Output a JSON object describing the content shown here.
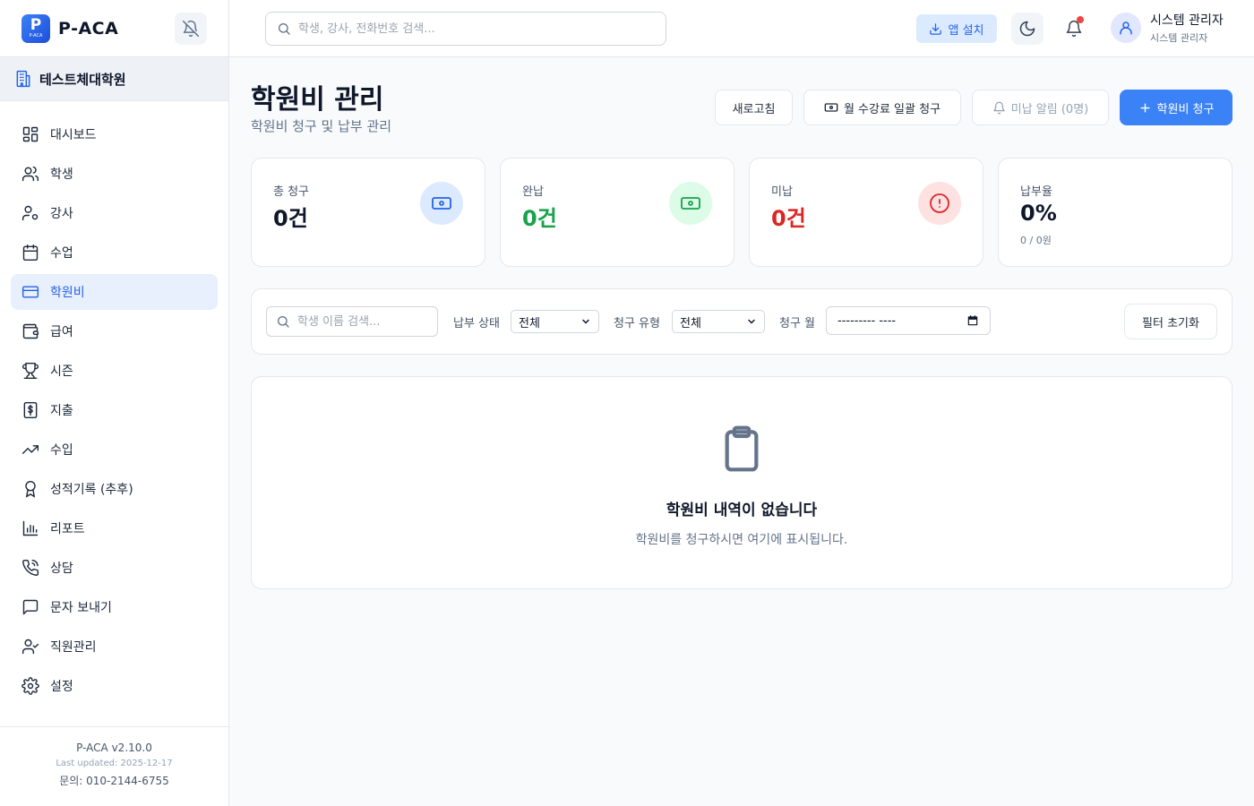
{
  "sidebar": {
    "logo_text": "P",
    "logo_sub": "P-ACA",
    "brand": "P-ACA",
    "academy": "테스트체대학원",
    "items": [
      {
        "label": "대시보드",
        "icon": "dashboard-icon"
      },
      {
        "label": "학생",
        "icon": "users-icon"
      },
      {
        "label": "강사",
        "icon": "user-cog-icon"
      },
      {
        "label": "수업",
        "icon": "calendar-icon"
      },
      {
        "label": "학원비",
        "icon": "credit-card-icon"
      },
      {
        "label": "급여",
        "icon": "wallet-icon"
      },
      {
        "label": "시즌",
        "icon": "trophy-icon"
      },
      {
        "label": "지출",
        "icon": "dollar-receipt-icon"
      },
      {
        "label": "수입",
        "icon": "trending-up-icon"
      },
      {
        "label": "성적기록 (추후)",
        "icon": "award-icon"
      },
      {
        "label": "리포트",
        "icon": "bar-chart-icon"
      },
      {
        "label": "상담",
        "icon": "phone-icon"
      },
      {
        "label": "문자 보내기",
        "icon": "message-icon"
      },
      {
        "label": "직원관리",
        "icon": "user-check-icon"
      },
      {
        "label": "설정",
        "icon": "settings-icon"
      }
    ],
    "active_index": 4,
    "footer": {
      "version": "P-ACA v2.10.0",
      "updated": "Last updated: 2025-12-17",
      "contact": "문의: 010-2144-6755"
    }
  },
  "header": {
    "search_placeholder": "학생, 강사, 전화번호 검색...",
    "install_label": "앱 설치",
    "user_name": "시스템 관리자",
    "user_role": "시스템 관리자"
  },
  "page": {
    "title": "학원비 관리",
    "subtitle": "학원비 청구 및 납부 관리",
    "buttons": {
      "refresh": "새로고침",
      "bulk": "월 수강료 일괄 청구",
      "unpaid_alert": "미납 알림 (0명)",
      "charge": "학원비 청구"
    }
  },
  "stats": [
    {
      "label": "총 청구",
      "value": "0건",
      "color": "#0f172a",
      "icon_bg": "#dbeafe",
      "icon_color": "#2563eb"
    },
    {
      "label": "완납",
      "value": "0건",
      "color": "#16a34a",
      "icon_bg": "#dcfce7",
      "icon_color": "#16a34a"
    },
    {
      "label": "미납",
      "value": "0건",
      "color": "#dc2626",
      "icon_bg": "#fee2e2",
      "icon_color": "#dc2626"
    },
    {
      "label": "납부율",
      "value": "0%",
      "color": "#0f172a",
      "sub": "0 / 0원"
    }
  ],
  "filters": {
    "search_placeholder": "학생 이름 검색...",
    "status_label": "납부 상태",
    "status_value": "전체",
    "type_label": "청구 유형",
    "type_value": "전체",
    "month_label": "청구 월",
    "month_value": "--------- ----",
    "reset": "필터 초기화"
  },
  "empty": {
    "title": "학원비 내역이 없습니다",
    "desc": "학원비를 청구하시면 여기에 표시됩니다."
  },
  "colors": {
    "accent": "#3b82f6",
    "active_bg": "#e8effd"
  }
}
